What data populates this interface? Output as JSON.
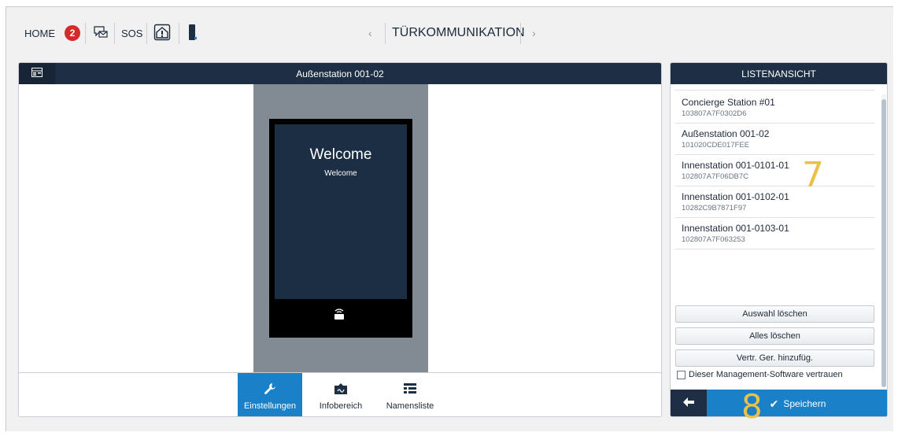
{
  "topbar": {
    "home_label": "HOME",
    "notification_count": "2",
    "sos_label": "SOS",
    "nav_title": "TÜRKOMMUNIKATION",
    "nav_prev": "‹",
    "nav_next": "›"
  },
  "left_panel": {
    "header_title": "Außenstation 001-02",
    "device_screen": {
      "title": "Welcome",
      "subtitle": "Welcome"
    },
    "footer_tabs": [
      {
        "label": "Einstellungen",
        "icon": "wrench-icon",
        "active": true
      },
      {
        "label": "Infobereich",
        "icon": "info-area-icon",
        "active": false
      },
      {
        "label": "Namensliste",
        "icon": "name-list-icon",
        "active": false
      }
    ]
  },
  "right_panel": {
    "header_title": "LISTENANSICHT",
    "items": [
      {
        "name": "Concierge Station #01",
        "id": "103807A7F0302D6"
      },
      {
        "name": "Außenstation 001-02",
        "id": "101020CDE017FEE"
      },
      {
        "name": "Innenstation 001-0101-01",
        "id": "102807A7F06DB7C"
      },
      {
        "name": "Innenstation 001-0102-01",
        "id": "10282C9B7871F97"
      },
      {
        "name": "Innenstation 001-0103-01",
        "id": "102807A7F063253"
      }
    ],
    "buttons": {
      "clear_selection": "Auswahl löschen",
      "clear_all": "Alles löschen",
      "add_trusted": "Vertr. Ger. hinzufüg."
    },
    "trust_label": "Dieser Management-Software vertrauen",
    "save_label": "Speichern"
  },
  "annotations": {
    "marker_7": "7",
    "marker_8": "8"
  },
  "colors": {
    "header": "#1e2f45",
    "accent": "#1a80c8",
    "badge": "#d62929",
    "annotation": "#e7c14a"
  }
}
